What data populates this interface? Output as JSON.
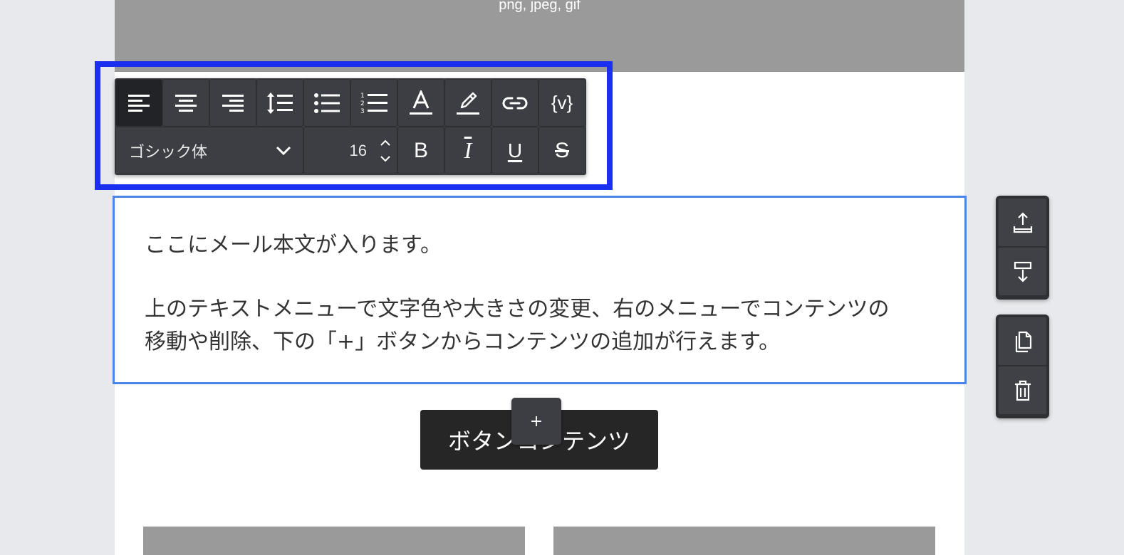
{
  "image_block": {
    "hint": "png, jpeg, gif"
  },
  "toolbar": {
    "row1": [
      {
        "name": "align-left-icon",
        "active": true
      },
      {
        "name": "align-center-icon"
      },
      {
        "name": "align-right-icon"
      },
      {
        "name": "line-height-icon"
      },
      {
        "name": "bullet-list-icon"
      },
      {
        "name": "numbered-list-icon"
      },
      {
        "name": "text-color-icon"
      },
      {
        "name": "highlight-color-icon"
      },
      {
        "name": "link-icon"
      },
      {
        "name": "variable-icon",
        "label": "{v}"
      }
    ],
    "font_family": "ゴシック体",
    "font_size": "16",
    "bold": "B",
    "italic": "I",
    "underline": "U",
    "strike": "S"
  },
  "text_block": {
    "line1": "ここにメール本文が入ります。",
    "line2": "上のテキストメニューで文字色や大きさの変更、右のメニューでコンテンツの",
    "line3": "移動や削除、下の「+」ボタンからコンテンツの追加が行えます。"
  },
  "cta": {
    "label": "ボタンコンテンツ"
  },
  "add_button": {
    "label": "+"
  },
  "side_menu": {
    "move_up": "move-up-icon",
    "move_down": "move-down-icon",
    "duplicate": "duplicate-icon",
    "delete": "trash-icon"
  },
  "colors": {
    "toolbar_bg": "#3c3e43",
    "selection_border": "#4a86e8",
    "highlight_box": "#1a2ff0",
    "button_bg": "#262626",
    "placeholder_gray": "#9a9a9a"
  }
}
